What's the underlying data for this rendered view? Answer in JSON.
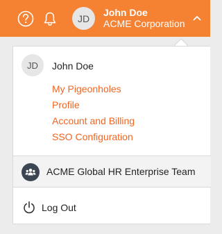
{
  "header": {
    "avatar_initials": "JD",
    "user_name": "John Doe",
    "organization": "ACME Corporation",
    "icons": {
      "help": "help-circle-icon",
      "notifications": "bell-icon",
      "menu_toggle": "chevron-up-icon"
    },
    "colors": {
      "background": "#f58233",
      "text": "#ffffff"
    }
  },
  "dropdown": {
    "avatar_initials": "JD",
    "user_name": "John Doe",
    "links": [
      {
        "label": "My Pigeonholes"
      },
      {
        "label": "Profile"
      },
      {
        "label": "Account and Billing"
      },
      {
        "label": "SSO Configuration"
      }
    ],
    "team": {
      "label": "ACME Global HR Enterprise Team",
      "icon": "team-icon"
    },
    "logout": {
      "label": "Log Out",
      "icon": "power-icon"
    },
    "colors": {
      "link": "#f26522",
      "team_background": "#f3f3f3"
    }
  }
}
